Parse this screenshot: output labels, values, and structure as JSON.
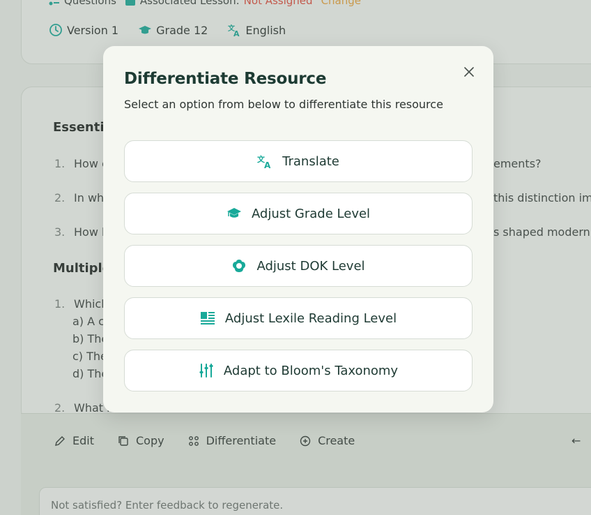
{
  "colors": {
    "accent": "#18a999",
    "title": "#1d3b33",
    "not_assigned": "#e04a3b",
    "change": "#e9a23b"
  },
  "header": {
    "questions_label": "Questions",
    "lesson_label": "Associated Lesson:",
    "lesson_value": "Not Assigned",
    "change_label": "Change",
    "version": "Version 1",
    "grade": "Grade 12",
    "language": "English"
  },
  "content": {
    "essential_heading": "Essential",
    "q1": "How c",
    "q1_tail": "ements?",
    "q2": "In wh",
    "q2_tail": "this distinction imp",
    "q3": "How h",
    "q3_tail": "s shaped modern c",
    "mc_heading": "Multiple",
    "mc1": "Which",
    "opt_a": "a) A c",
    "opt_b": "b) The",
    "opt_c": "c) The",
    "opt_d": "d) The",
    "mc2": "What i"
  },
  "actions": {
    "edit": "Edit",
    "copy": "Copy",
    "differentiate": "Differentiate",
    "create": "Create",
    "back": "←"
  },
  "feedback": {
    "placeholder": "Not satisfied? Enter feedback to regenerate."
  },
  "modal": {
    "title": "Differentiate Resource",
    "subtitle": "Select an option from below to differentiate this resource",
    "options": [
      {
        "label": "Translate",
        "icon": "translate-icon"
      },
      {
        "label": "Adjust Grade Level",
        "icon": "graduation-cap-icon"
      },
      {
        "label": "Adjust DOK Level",
        "icon": "dok-icon"
      },
      {
        "label": "Adjust Lexile Reading Level",
        "icon": "article-icon"
      },
      {
        "label": "Adapt to Bloom's Taxonomy",
        "icon": "sliders-icon"
      }
    ]
  }
}
